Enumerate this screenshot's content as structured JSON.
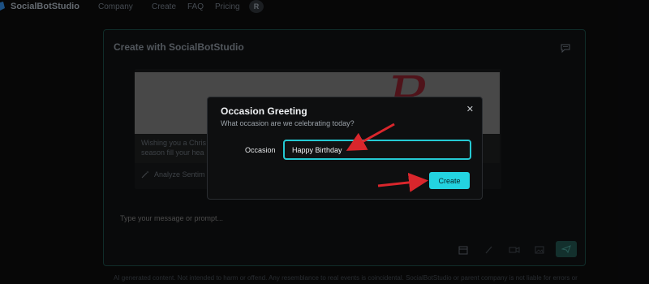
{
  "nav": {
    "brand": "SocialBotStudio",
    "links": [
      "Company",
      "Create",
      "FAQ",
      "Pricing"
    ],
    "avatar_initial": "R"
  },
  "card": {
    "title": "Create with SocialBotStudio",
    "preview": {
      "message_line1": "Wishing you a Chris",
      "message_line2": "season fill your hea",
      "analyze_label": "Analyze Sentim"
    },
    "prompt_placeholder": "Type your message or prompt..."
  },
  "disclaimer": "AI generated content. Not intended to harm or offend. Any resemblance to real events is coincidental. SocialBotStudio or parent company is not liable for errors or",
  "modal": {
    "title": "Occasion Greeting",
    "subtitle": "What occasion are we celebrating today?",
    "close_glyph": "✕",
    "field_label": "Occasion",
    "field_value": "Happy Birthday",
    "create_label": "Create"
  },
  "colors": {
    "accent": "#23d3e0",
    "annotation_arrow": "#d9262c",
    "card_border": "#19443f"
  }
}
